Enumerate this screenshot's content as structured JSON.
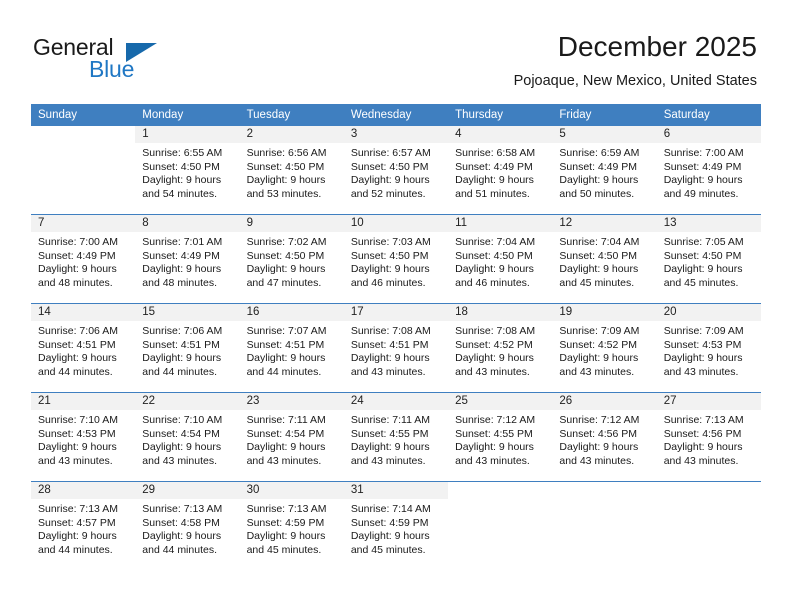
{
  "brand": {
    "word1": "General",
    "word2": "Blue",
    "triangle_color": "#1769ab",
    "blue_color": "#1f77c4"
  },
  "header": {
    "title": "December 2025",
    "location": "Pojoaque, New Mexico, United States",
    "header_bg": "#3f7fc0"
  },
  "weekday_headers": [
    "Sunday",
    "Monday",
    "Tuesday",
    "Wednesday",
    "Thursday",
    "Friday",
    "Saturday"
  ],
  "weeks": [
    [
      {
        "day": "",
        "blank": true
      },
      {
        "day": "1",
        "sunrise": "Sunrise: 6:55 AM",
        "sunset": "Sunset: 4:50 PM",
        "daylight1": "Daylight: 9 hours",
        "daylight2": "and 54 minutes."
      },
      {
        "day": "2",
        "sunrise": "Sunrise: 6:56 AM",
        "sunset": "Sunset: 4:50 PM",
        "daylight1": "Daylight: 9 hours",
        "daylight2": "and 53 minutes."
      },
      {
        "day": "3",
        "sunrise": "Sunrise: 6:57 AM",
        "sunset": "Sunset: 4:50 PM",
        "daylight1": "Daylight: 9 hours",
        "daylight2": "and 52 minutes."
      },
      {
        "day": "4",
        "sunrise": "Sunrise: 6:58 AM",
        "sunset": "Sunset: 4:49 PM",
        "daylight1": "Daylight: 9 hours",
        "daylight2": "and 51 minutes."
      },
      {
        "day": "5",
        "sunrise": "Sunrise: 6:59 AM",
        "sunset": "Sunset: 4:49 PM",
        "daylight1": "Daylight: 9 hours",
        "daylight2": "and 50 minutes."
      },
      {
        "day": "6",
        "sunrise": "Sunrise: 7:00 AM",
        "sunset": "Sunset: 4:49 PM",
        "daylight1": "Daylight: 9 hours",
        "daylight2": "and 49 minutes."
      }
    ],
    [
      {
        "day": "7",
        "sunrise": "Sunrise: 7:00 AM",
        "sunset": "Sunset: 4:49 PM",
        "daylight1": "Daylight: 9 hours",
        "daylight2": "and 48 minutes."
      },
      {
        "day": "8",
        "sunrise": "Sunrise: 7:01 AM",
        "sunset": "Sunset: 4:49 PM",
        "daylight1": "Daylight: 9 hours",
        "daylight2": "and 48 minutes."
      },
      {
        "day": "9",
        "sunrise": "Sunrise: 7:02 AM",
        "sunset": "Sunset: 4:50 PM",
        "daylight1": "Daylight: 9 hours",
        "daylight2": "and 47 minutes."
      },
      {
        "day": "10",
        "sunrise": "Sunrise: 7:03 AM",
        "sunset": "Sunset: 4:50 PM",
        "daylight1": "Daylight: 9 hours",
        "daylight2": "and 46 minutes."
      },
      {
        "day": "11",
        "sunrise": "Sunrise: 7:04 AM",
        "sunset": "Sunset: 4:50 PM",
        "daylight1": "Daylight: 9 hours",
        "daylight2": "and 46 minutes."
      },
      {
        "day": "12",
        "sunrise": "Sunrise: 7:04 AM",
        "sunset": "Sunset: 4:50 PM",
        "daylight1": "Daylight: 9 hours",
        "daylight2": "and 45 minutes."
      },
      {
        "day": "13",
        "sunrise": "Sunrise: 7:05 AM",
        "sunset": "Sunset: 4:50 PM",
        "daylight1": "Daylight: 9 hours",
        "daylight2": "and 45 minutes."
      }
    ],
    [
      {
        "day": "14",
        "sunrise": "Sunrise: 7:06 AM",
        "sunset": "Sunset: 4:51 PM",
        "daylight1": "Daylight: 9 hours",
        "daylight2": "and 44 minutes."
      },
      {
        "day": "15",
        "sunrise": "Sunrise: 7:06 AM",
        "sunset": "Sunset: 4:51 PM",
        "daylight1": "Daylight: 9 hours",
        "daylight2": "and 44 minutes."
      },
      {
        "day": "16",
        "sunrise": "Sunrise: 7:07 AM",
        "sunset": "Sunset: 4:51 PM",
        "daylight1": "Daylight: 9 hours",
        "daylight2": "and 44 minutes."
      },
      {
        "day": "17",
        "sunrise": "Sunrise: 7:08 AM",
        "sunset": "Sunset: 4:51 PM",
        "daylight1": "Daylight: 9 hours",
        "daylight2": "and 43 minutes."
      },
      {
        "day": "18",
        "sunrise": "Sunrise: 7:08 AM",
        "sunset": "Sunset: 4:52 PM",
        "daylight1": "Daylight: 9 hours",
        "daylight2": "and 43 minutes."
      },
      {
        "day": "19",
        "sunrise": "Sunrise: 7:09 AM",
        "sunset": "Sunset: 4:52 PM",
        "daylight1": "Daylight: 9 hours",
        "daylight2": "and 43 minutes."
      },
      {
        "day": "20",
        "sunrise": "Sunrise: 7:09 AM",
        "sunset": "Sunset: 4:53 PM",
        "daylight1": "Daylight: 9 hours",
        "daylight2": "and 43 minutes."
      }
    ],
    [
      {
        "day": "21",
        "sunrise": "Sunrise: 7:10 AM",
        "sunset": "Sunset: 4:53 PM",
        "daylight1": "Daylight: 9 hours",
        "daylight2": "and 43 minutes."
      },
      {
        "day": "22",
        "sunrise": "Sunrise: 7:10 AM",
        "sunset": "Sunset: 4:54 PM",
        "daylight1": "Daylight: 9 hours",
        "daylight2": "and 43 minutes."
      },
      {
        "day": "23",
        "sunrise": "Sunrise: 7:11 AM",
        "sunset": "Sunset: 4:54 PM",
        "daylight1": "Daylight: 9 hours",
        "daylight2": "and 43 minutes."
      },
      {
        "day": "24",
        "sunrise": "Sunrise: 7:11 AM",
        "sunset": "Sunset: 4:55 PM",
        "daylight1": "Daylight: 9 hours",
        "daylight2": "and 43 minutes."
      },
      {
        "day": "25",
        "sunrise": "Sunrise: 7:12 AM",
        "sunset": "Sunset: 4:55 PM",
        "daylight1": "Daylight: 9 hours",
        "daylight2": "and 43 minutes."
      },
      {
        "day": "26",
        "sunrise": "Sunrise: 7:12 AM",
        "sunset": "Sunset: 4:56 PM",
        "daylight1": "Daylight: 9 hours",
        "daylight2": "and 43 minutes."
      },
      {
        "day": "27",
        "sunrise": "Sunrise: 7:13 AM",
        "sunset": "Sunset: 4:56 PM",
        "daylight1": "Daylight: 9 hours",
        "daylight2": "and 43 minutes."
      }
    ],
    [
      {
        "day": "28",
        "sunrise": "Sunrise: 7:13 AM",
        "sunset": "Sunset: 4:57 PM",
        "daylight1": "Daylight: 9 hours",
        "daylight2": "and 44 minutes."
      },
      {
        "day": "29",
        "sunrise": "Sunrise: 7:13 AM",
        "sunset": "Sunset: 4:58 PM",
        "daylight1": "Daylight: 9 hours",
        "daylight2": "and 44 minutes."
      },
      {
        "day": "30",
        "sunrise": "Sunrise: 7:13 AM",
        "sunset": "Sunset: 4:59 PM",
        "daylight1": "Daylight: 9 hours",
        "daylight2": "and 45 minutes."
      },
      {
        "day": "31",
        "sunrise": "Sunrise: 7:14 AM",
        "sunset": "Sunset: 4:59 PM",
        "daylight1": "Daylight: 9 hours",
        "daylight2": "and 45 minutes."
      },
      {
        "day": "",
        "blank": true
      },
      {
        "day": "",
        "blank": true
      },
      {
        "day": "",
        "blank": true
      }
    ]
  ]
}
